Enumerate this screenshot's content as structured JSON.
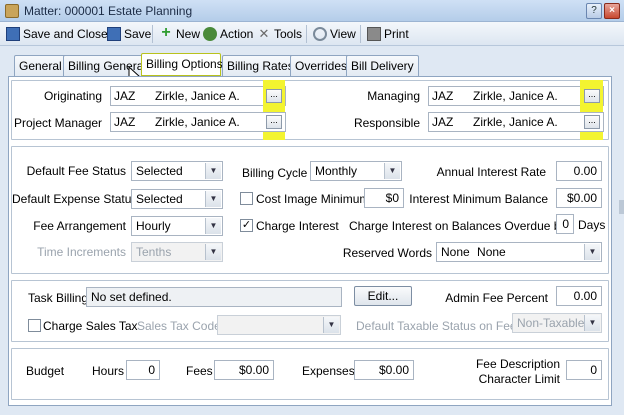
{
  "window": {
    "title": "Matter: 000001 Estate Planning",
    "controls": [
      "?",
      "×"
    ]
  },
  "toolbar": {
    "save_close": "Save and Close",
    "save": "Save",
    "new": "New",
    "action": "Action",
    "tools": "Tools",
    "view": "View",
    "print": "Print"
  },
  "tabs": [
    "General",
    "Billing General",
    "Billing Options",
    "Billing Rates",
    "Overrides",
    "Bill Delivery"
  ],
  "people": {
    "originating": {
      "label": "Originating",
      "code": "JAZ",
      "name": "Zirkle, Janice A."
    },
    "project_manager": {
      "label": "Project Manager",
      "code": "JAZ",
      "name": "Zirkle, Janice A."
    },
    "managing": {
      "label": "Managing",
      "code": "JAZ",
      "name": "Zirkle, Janice A."
    },
    "responsible": {
      "label": "Responsible",
      "code": "JAZ",
      "name": "Zirkle, Janice A."
    },
    "lookup_button": "..."
  },
  "options": {
    "default_fee_status": {
      "label": "Default Fee Status",
      "value": "Selected"
    },
    "default_expense_status": {
      "label": "Default Expense Status",
      "value": "Selected"
    },
    "fee_arrangement": {
      "label": "Fee Arrangement",
      "value": "Hourly"
    },
    "time_increments": {
      "label": "Time Increments",
      "value": "Tenths"
    },
    "billing_cycle": {
      "label": "Billing Cycle",
      "value": "Monthly"
    },
    "cost_image_minimum": {
      "label": "Cost Image Minimum",
      "value": "$0",
      "checked": false
    },
    "charge_interest": {
      "label": "Charge Interest",
      "checked": true
    },
    "annual_interest_rate": {
      "label": "Annual Interest Rate",
      "value": "0.00"
    },
    "interest_minimum_balance": {
      "label": "Interest Minimum Balance",
      "value": "$0.00"
    },
    "charge_interest_overdue": {
      "label": "Charge Interest on Balances Overdue by",
      "value": "0",
      "unit": "Days"
    },
    "reserved_words": {
      "label": "Reserved Words",
      "code": "None",
      "value": "None"
    }
  },
  "task_billing": {
    "label": "Task Billing",
    "value": "No set defined.",
    "edit_button": "Edit...",
    "admin_fee_label": "Admin Fee Percent",
    "admin_fee_value": "0.00",
    "charge_sales_tax": {
      "label": "Charge Sales Tax",
      "checked": false
    },
    "sales_tax_code_label": "Sales Tax Code",
    "sales_tax_code_value": "",
    "default_taxable_label": "Default Taxable Status on Fees",
    "default_taxable_value": "Non-Taxable"
  },
  "budget": {
    "label": "Budget",
    "hours_label": "Hours",
    "hours_value": "0",
    "fees_label": "Fees",
    "fees_value": "$0.00",
    "expenses_label": "Expenses",
    "expenses_value": "$0.00",
    "fee_desc_label_1": "Fee Description",
    "fee_desc_label_2": "Character Limit",
    "fee_desc_value": "0"
  },
  "colors": {
    "highlight": "#eaf23a",
    "window_bg": "#dfe8f3"
  }
}
